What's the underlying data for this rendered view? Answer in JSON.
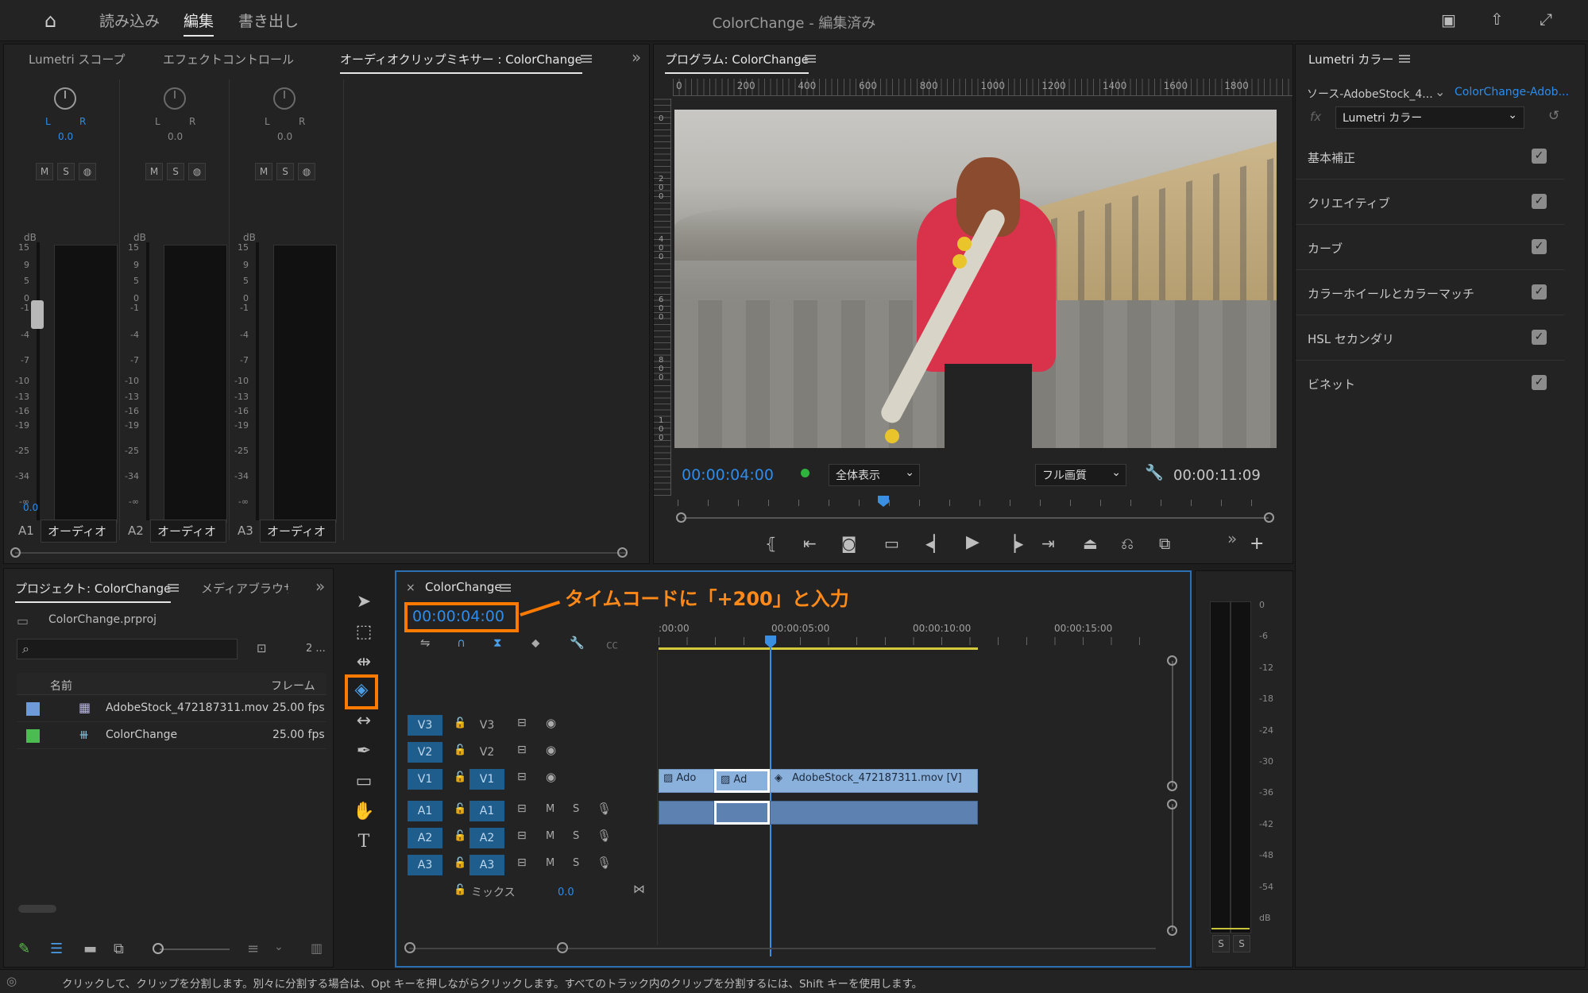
{
  "workspace": {
    "home_icon": "home-icon",
    "tabs": [
      "読み込み",
      "編集",
      "書き出し"
    ],
    "active": "編集",
    "title": "ColorChange - 編集済み"
  },
  "audio_mixer": {
    "tabs": [
      "Lumetri スコープ",
      "エフェクトコントロール",
      "オーディオクリップミキサー : ColorChange"
    ],
    "lr": "L",
    "lr2": "R",
    "db": "dB",
    "pan": [
      "0.0",
      "0.0",
      "0.0"
    ],
    "m": "M",
    "s": "S",
    "ticks": [
      "15",
      "9",
      "5",
      "0",
      "-1",
      "-4",
      "-7",
      "-10",
      "-13",
      "-16",
      "-19",
      "-25",
      "-34",
      "-∞"
    ],
    "level": "0.0",
    "channels": [
      {
        "id": "A1",
        "name": "オーディオ"
      },
      {
        "id": "A2",
        "name": "オーディオ"
      },
      {
        "id": "A3",
        "name": "オーディオ"
      }
    ]
  },
  "program": {
    "title": "プログラム: ColorChange",
    "ruler": [
      "0",
      "200",
      "400",
      "600",
      "800",
      "1000",
      "1200",
      "1400",
      "1600",
      "1800"
    ],
    "vruler": [
      "0",
      "2\n0\n0",
      "4\n0\n0",
      "6\n0\n0",
      "8\n0\n0",
      "1\n0\n0"
    ],
    "timecode": "00:00:04:00",
    "zoom": "全体表示",
    "quality": "フル画質",
    "duration": "00:00:11:09",
    "playhead_fraction": 0.34
  },
  "lumetri": {
    "title": "Lumetri カラー",
    "source": "ソース-AdobeStock_4...",
    "target": "ColorChange-Adob...",
    "effect": "Lumetri カラー",
    "fx": "fx",
    "sections": [
      "基本補正",
      "クリエイティブ",
      "カーブ",
      "カラーホイールとカラーマッチ",
      "HSL セカンダリ",
      "ビネット"
    ]
  },
  "project": {
    "tabs": [
      "プロジェクト: ColorChange",
      "メディアブラウザ"
    ],
    "file": "ColorChange.prproj",
    "count": "2 ...",
    "columns": [
      "名前",
      "フレーム"
    ],
    "items": [
      {
        "name": "AdobeStock_472187311.mov",
        "fps": "25.00 fps",
        "color": "#6f9ad8"
      },
      {
        "name": "ColorChange",
        "fps": "25.00 fps",
        "color": "#4cbb52"
      }
    ]
  },
  "timeline": {
    "title": "ColorChange",
    "timecode": "00:00:04:00",
    "ruler": [
      ":00:00",
      "00:00:05:00",
      "00:00:10:00",
      "00:00:15:00"
    ],
    "annotation": "タイムコードに「+200」と入力",
    "tracks": [
      {
        "id": "V3",
        "tag": "V3"
      },
      {
        "id": "V2",
        "tag": "V2"
      },
      {
        "id": "V1",
        "tag": "V1"
      },
      {
        "id": "A1",
        "tag": "A1"
      },
      {
        "id": "A2",
        "tag": "A2"
      },
      {
        "id": "A3",
        "tag": "A3"
      }
    ],
    "m": "M",
    "s": "S",
    "mix": "ミックス",
    "mix_value": "0.0",
    "clips": {
      "c1": "Ado",
      "c2": "Ad",
      "c3": "AdobeStock_472187311.mov [V]"
    }
  },
  "meters": {
    "ticks": [
      "0",
      "-6",
      "-12",
      "-18",
      "-24",
      "-30",
      "-36",
      "-42",
      "-48",
      "-54",
      "dB"
    ],
    "s": "S"
  },
  "status": "クリックして、クリップを分割します。別々に分割する場合は、Opt キーを押しながらクリックします。すべてのトラック内のクリップを分割するには、Shift キーを使用します。",
  "accent": "#2d8ceb",
  "highlight": "#ff7a00"
}
